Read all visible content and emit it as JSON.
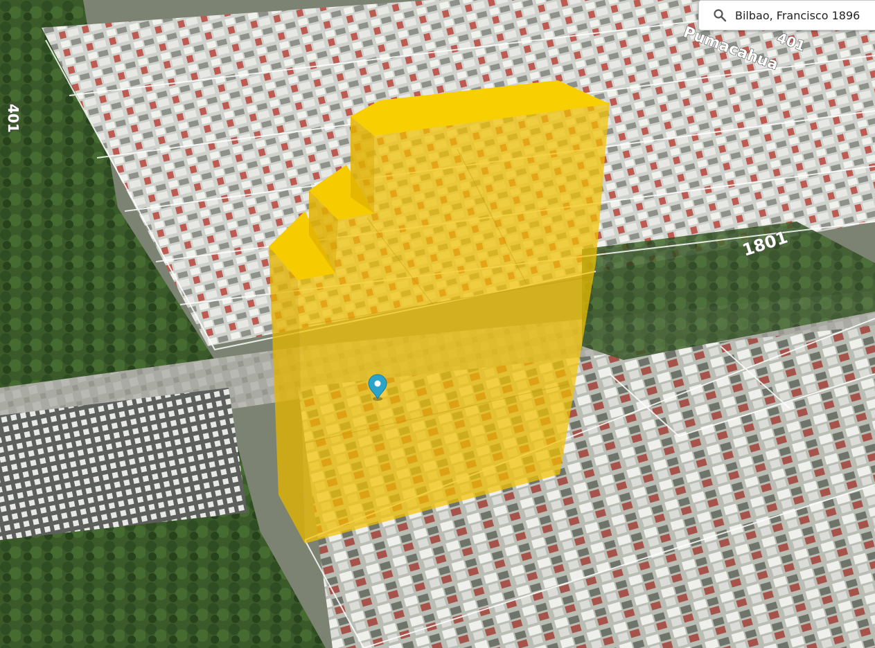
{
  "search": {
    "value": "Bilbao, Francisco 1896",
    "icon": "search-icon"
  },
  "map": {
    "view": "3d-satellite",
    "street_labels": [
      {
        "text": "Pumacahua",
        "name": "street-label-pumacahua"
      },
      {
        "text": "401",
        "name": "street-label-401-top"
      },
      {
        "text": "401",
        "name": "street-label-401-left"
      },
      {
        "text": "1801",
        "name": "street-label-1801"
      }
    ],
    "volume_color": "#f5c400",
    "marker": {
      "icon": "location-pin-icon",
      "color": "#2aa4c8"
    }
  }
}
